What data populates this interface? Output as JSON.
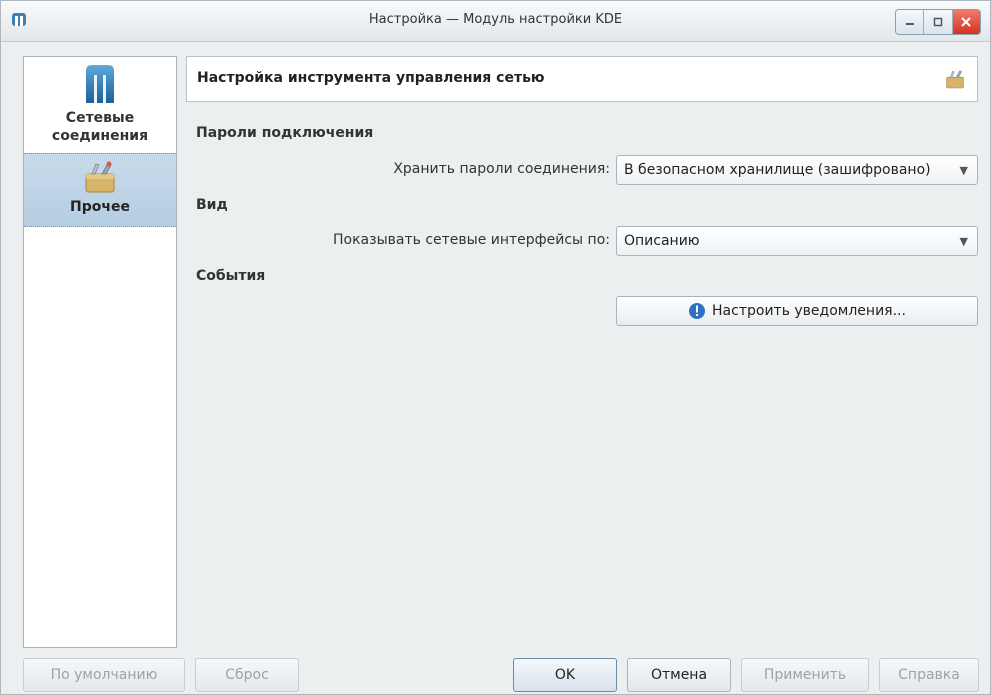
{
  "window": {
    "title": "Настройка — Модуль настройки KDE"
  },
  "sidebar": {
    "items": [
      {
        "label": "Сетевые соединения",
        "icon": "network-manager-icon",
        "selected": false
      },
      {
        "label": "Прочее",
        "icon": "toolbox-icon",
        "selected": true
      }
    ]
  },
  "header": {
    "title": "Настройка инструмента управления сетью",
    "icon": "toolbox-icon"
  },
  "sections": {
    "passwords": {
      "title": "Пароли подключения",
      "store_label": "Хранить пароли соединения:",
      "store_value": "В безопасном хранилище (зашифровано)"
    },
    "view": {
      "title": "Вид",
      "show_label": "Показывать сетевые интерфейсы по:",
      "show_value": "Описанию"
    },
    "events": {
      "title": "События",
      "notify_button": "Настроить уведомления..."
    }
  },
  "buttons": {
    "defaults": "По умолчанию",
    "reset": "Сброс",
    "ok": "OK",
    "cancel": "Отмена",
    "apply": "Применить",
    "help": "Справка"
  },
  "colors": {
    "selection": "#b5cde2",
    "close_button": "#d6321f",
    "info_icon": "#2f6fc4"
  }
}
